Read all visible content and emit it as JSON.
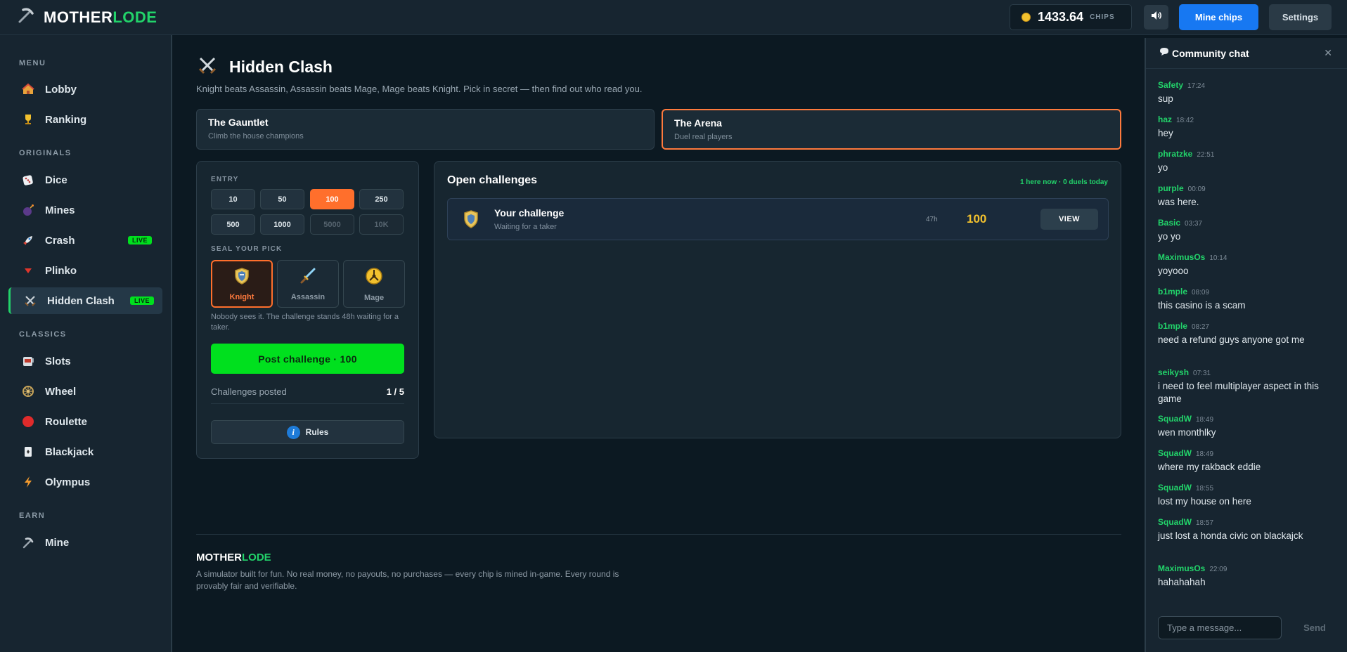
{
  "header": {
    "logo_main": "MOTHER",
    "logo_accent": "LODE",
    "balance": "1433.64",
    "balance_unit": "CHIPS",
    "mine_chips_label": "Mine chips",
    "settings_label": "Settings"
  },
  "sidebar": {
    "sections": [
      "MENU",
      "ORIGINALS",
      "CLASSICS",
      "EARN"
    ],
    "items": [
      {
        "label": "Lobby",
        "icon": "house-icon"
      },
      {
        "label": "Ranking",
        "icon": "trophy-icon"
      },
      {
        "label": "Dice",
        "icon": "dice-icon"
      },
      {
        "label": "Mines",
        "icon": "bomb-icon"
      },
      {
        "label": "Crash",
        "icon": "rocket-icon",
        "badge": "LIVE"
      },
      {
        "label": "Plinko",
        "icon": "triangle-icon"
      },
      {
        "label": "Hidden Clash",
        "icon": "crossed-swords-icon",
        "badge": "LIVE",
        "active": true
      },
      {
        "label": "Slots",
        "icon": "slot-machine-icon"
      },
      {
        "label": "Wheel",
        "icon": "wheel-icon"
      },
      {
        "label": "Roulette",
        "icon": "roulette-icon"
      },
      {
        "label": "Blackjack",
        "icon": "cards-icon"
      },
      {
        "label": "Olympus",
        "icon": "lightning-icon"
      },
      {
        "label": "Mine",
        "icon": "pickaxe-icon"
      }
    ]
  },
  "main": {
    "title": "Hidden Clash",
    "subtitle": "Knight beats Assassin, Assassin beats Mage, Mage beats Knight. Pick in secret — then find out who read you.",
    "modes": [
      {
        "title": "The Gauntlet",
        "sub": "Climb the house champions"
      },
      {
        "title": "The Arena",
        "sub": "Duel real players",
        "active": true
      }
    ],
    "entry_label": "ENTRY",
    "entry_options": [
      "10",
      "50",
      "100",
      "250",
      "500",
      "1000",
      "5000",
      "10K"
    ],
    "entry_selected": "100",
    "seal_label": "SEAL YOUR PICK",
    "picks": [
      {
        "label": "Knight",
        "icon": "shield-icon",
        "selected": true
      },
      {
        "label": "Assassin",
        "icon": "dagger-icon"
      },
      {
        "label": "Mage",
        "icon": "magic-orb-icon"
      }
    ],
    "pick_note": "Nobody sees it. The challenge stands 48h waiting for a taker.",
    "post_button": "Post challenge · 100",
    "posted_label": "Challenges posted",
    "posted_value": "1 / 5",
    "rules_label": "Rules"
  },
  "challenges": {
    "title": "Open challenges",
    "stats": "1 here now · 0 duels today",
    "rows": [
      {
        "name": "Your challenge",
        "status": "Waiting for a taker",
        "time_left": "47h",
        "amount": "100",
        "action": "VIEW"
      }
    ]
  },
  "footer": {
    "logo_main": "MOTHER",
    "logo_accent": "LODE",
    "text": "A simulator built for fun. No real money, no payouts, no purchases — every chip is mined in-game. Every round is provably fair and verifiable."
  },
  "chat": {
    "title": "Community chat",
    "messages": [
      {
        "user": "Safety",
        "time": "17:24",
        "text": "sup"
      },
      {
        "user": "haz",
        "time": "18:42",
        "text": "hey"
      },
      {
        "user": "phratzke",
        "time": "22:51",
        "text": "yo"
      },
      {
        "user": "purple",
        "time": "00:09",
        "text": "was here."
      },
      {
        "user": "Basic",
        "time": "03:37",
        "text": "yo yo"
      },
      {
        "user": "MaximusOs",
        "time": "10:14",
        "text": "yoyooo"
      },
      {
        "user": "b1mple",
        "time": "08:09",
        "text": "this casino is a scam"
      },
      {
        "user": "b1mple",
        "time": "08:27",
        "text": "need a refund guys anyone got me"
      },
      {
        "user": "seikysh",
        "time": "07:31",
        "text": "i need to feel multiplayer aspect in this game"
      },
      {
        "user": "SquadW",
        "time": "18:49",
        "text": "wen monthlky"
      },
      {
        "user": "SquadW",
        "time": "18:49",
        "text": "where my rakback eddie"
      },
      {
        "user": "SquadW",
        "time": "18:55",
        "text": "lost my house on here"
      },
      {
        "user": "SquadW",
        "time": "18:57",
        "text": "just lost a honda civic on blackajck"
      },
      {
        "user": "MaximusOs",
        "time": "22:09",
        "text": "hahahahah"
      }
    ],
    "input_placeholder": "Type a message...",
    "send_label": "Send"
  },
  "colors": {
    "accent_green": "#22d36a",
    "live_green": "#00e01e",
    "accent_orange": "#ff6f2c",
    "primary_blue": "#1778f2",
    "gold": "#f2c12e"
  }
}
